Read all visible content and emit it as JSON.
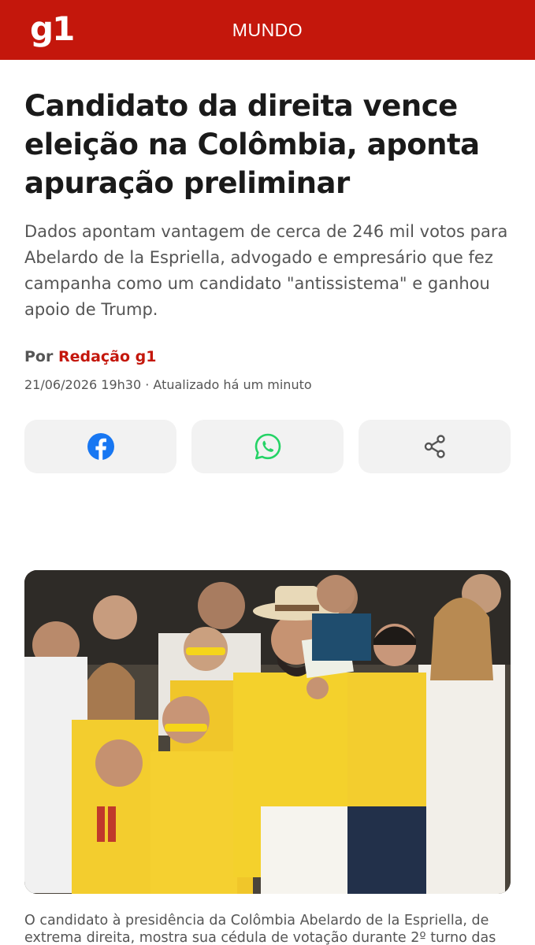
{
  "header": {
    "logo_text": "g1",
    "section": "MUNDO",
    "background_color": "#c4170c"
  },
  "article": {
    "headline": "Candidato da direita vence eleição na Colômbia, aponta apuração preliminar",
    "subtitle": "Dados apontam vantagem de cerca de 246 mil votos para Abelardo de la Espriella, advogado e empresário que fez campanha como um candidato \"antissistema\" e ganhou apoio de Trump.",
    "byline_prefix": "Por",
    "author": "Redação g1",
    "datetime": "21/06/2026 19h30 · Atualizado há um minuto"
  },
  "share": {
    "buttons": [
      {
        "icon": "facebook-icon",
        "color": "#1877f2"
      },
      {
        "icon": "whatsapp-icon",
        "color": "#25d366"
      },
      {
        "icon": "share-icon",
        "color": "#555555"
      }
    ]
  },
  "photo": {
    "caption": "O candidato à presidência da Colômbia Abelardo de la Espriella, de extrema direita, mostra sua cédula de votação durante 2º turno das"
  }
}
